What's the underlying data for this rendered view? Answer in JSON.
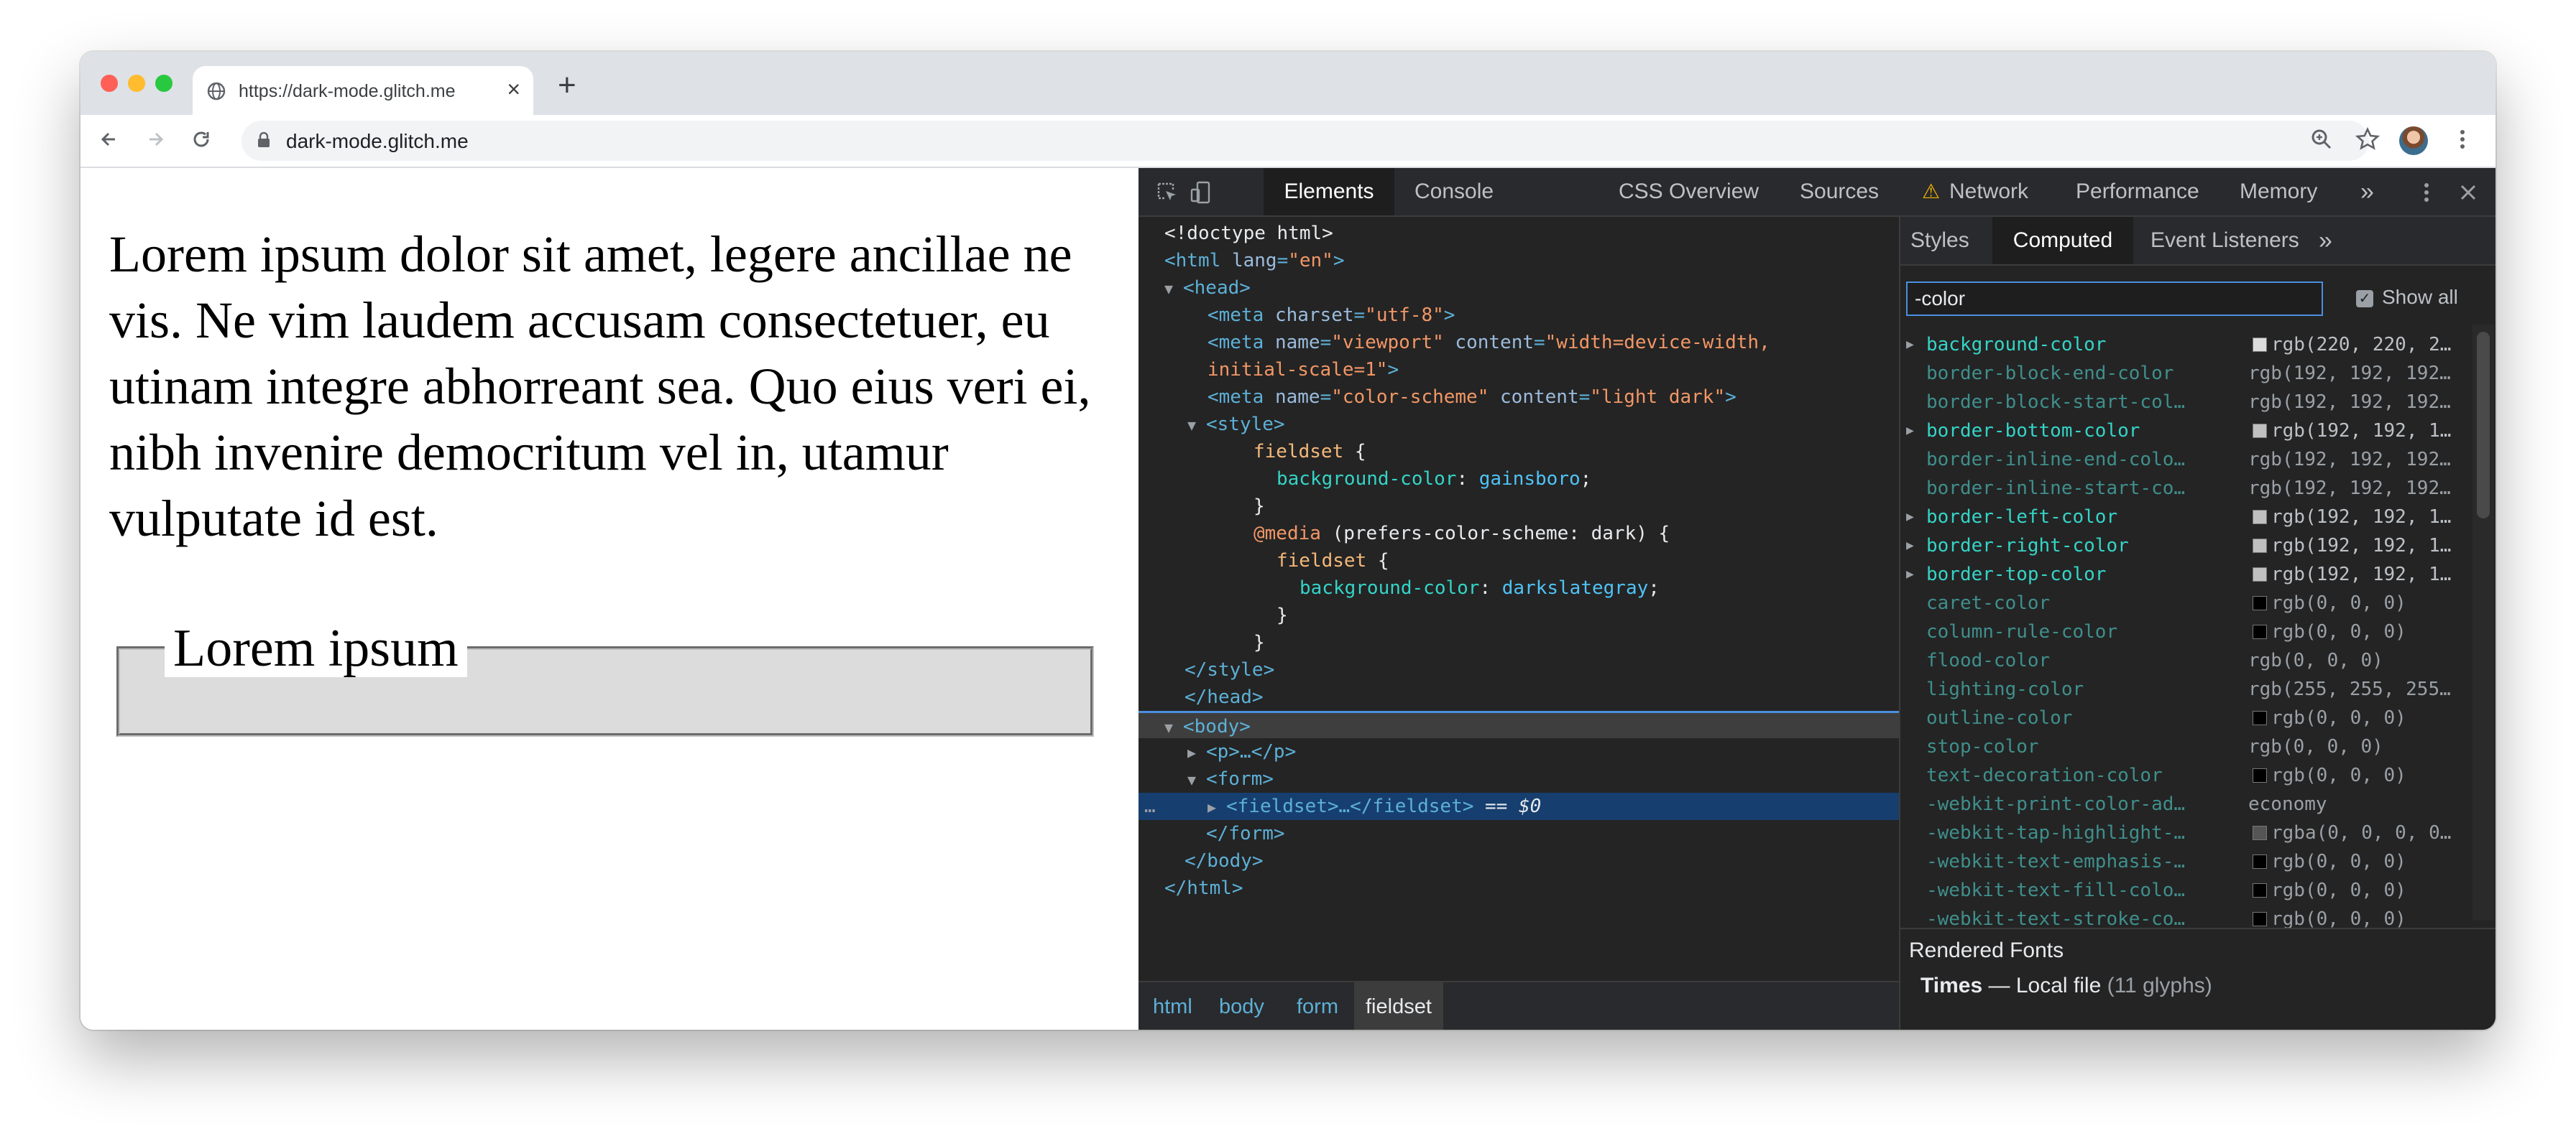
{
  "browser": {
    "tab_title": "https://dark-mode.glitch.me",
    "new_tab": "+",
    "address": "dark-mode.glitch.me"
  },
  "page": {
    "paragraph": "Lorem ipsum dolor sit amet, legere ancillae ne vis. Ne vim laudem accusam consectetuer, eu utinam integre abhorreant sea. Quo eius veri ei, nibh invenire democritum vel in, utamur vulputate id est.",
    "legend": "Lorem ipsum",
    "fieldset_bg": "#dcdcdc"
  },
  "devtools": {
    "tabs": [
      "Elements",
      "Console",
      "CSS Overview",
      "Sources",
      "Network",
      "Performance",
      "Memory"
    ],
    "more_tabs": "»",
    "network_warning": "⚠",
    "elements": {
      "doctype": "<!doctype html>",
      "html_open": "<html",
      "html_lang_attr": "lang",
      "html_lang_val": "\"en\"",
      "head_open": "<head>",
      "meta1_tag": "<meta",
      "meta1_attr": "charset",
      "meta1_val": "\"utf-8\"",
      "meta2_tag": "<meta",
      "meta2_name_attr": "name",
      "meta2_name_val": "\"viewport\"",
      "meta2_content_attr": "content",
      "meta2_content_val1": "\"width=device-width,",
      "meta2_content_val2": "initial-scale=1\"",
      "meta3_tag": "<meta",
      "meta3_name_attr": "name",
      "meta3_name_val": "\"color-scheme\"",
      "meta3_content_attr": "content",
      "meta3_content_val": "\"light dark\"",
      "style_open": "<style>",
      "css_sel1": "fieldset",
      "css_brace_open": "{",
      "css_prop1": "background-color",
      "css_val1": "gainsboro",
      "css_brace_close": "}",
      "css_at": "@media",
      "css_media_query": "(prefers-color-scheme: dark) {",
      "css_sel2": "fieldset",
      "css_prop2": "background-color",
      "css_val2": "darkslategray",
      "style_close": "</style>",
      "head_close": "</head>",
      "body_open": "<body>",
      "p_collapsed": "<p>…</p>",
      "form_open": "<form>",
      "fieldset_collapsed": "<fieldset>…</fieldset>",
      "dollar_zero": "== $0",
      "gutter_dots": "…",
      "form_close": "</form>",
      "body_close": "</body>",
      "html_close": "</html>"
    },
    "breadcrumbs": [
      "html",
      "body",
      "form",
      "fieldset"
    ],
    "side_tabs": [
      "Styles",
      "Computed",
      "Event Listeners"
    ],
    "side_more": "»",
    "filter_value": "-color",
    "show_all_label": "Show all",
    "show_all_checked": true,
    "computed": [
      {
        "name": "background-color",
        "value": "rgb(220, 220, 2…",
        "swatch": "#dcdcdc",
        "expandable": true,
        "inherited": true
      },
      {
        "name": "border-block-end-color",
        "value": "rgb(192, 192, 192…",
        "swatch": "",
        "expandable": false,
        "inherited": false
      },
      {
        "name": "border-block-start-col…",
        "value": "rgb(192, 192, 192…",
        "swatch": "",
        "expandable": false,
        "inherited": false
      },
      {
        "name": "border-bottom-color",
        "value": "rgb(192, 192, 1…",
        "swatch": "#c0c0c0",
        "expandable": true,
        "inherited": true
      },
      {
        "name": "border-inline-end-colo…",
        "value": "rgb(192, 192, 192…",
        "swatch": "",
        "expandable": false,
        "inherited": false
      },
      {
        "name": "border-inline-start-co…",
        "value": "rgb(192, 192, 192…",
        "swatch": "",
        "expandable": false,
        "inherited": false
      },
      {
        "name": "border-left-color",
        "value": "rgb(192, 192, 1…",
        "swatch": "#c0c0c0",
        "expandable": true,
        "inherited": true
      },
      {
        "name": "border-right-color",
        "value": "rgb(192, 192, 1…",
        "swatch": "#c0c0c0",
        "expandable": true,
        "inherited": true
      },
      {
        "name": "border-top-color",
        "value": "rgb(192, 192, 1…",
        "swatch": "#c0c0c0",
        "expandable": true,
        "inherited": true
      },
      {
        "name": "caret-color",
        "value": "rgb(0, 0, 0)",
        "swatch": "#000000",
        "expandable": false,
        "inherited": false
      },
      {
        "name": "column-rule-color",
        "value": "rgb(0, 0, 0)",
        "swatch": "#000000",
        "expandable": false,
        "inherited": false
      },
      {
        "name": "flood-color",
        "value": "rgb(0, 0, 0)",
        "swatch": "",
        "expandable": false,
        "inherited": false
      },
      {
        "name": "lighting-color",
        "value": "rgb(255, 255, 255…",
        "swatch": "",
        "expandable": false,
        "inherited": false
      },
      {
        "name": "outline-color",
        "value": "rgb(0, 0, 0)",
        "swatch": "#000000",
        "expandable": false,
        "inherited": false
      },
      {
        "name": "stop-color",
        "value": "rgb(0, 0, 0)",
        "swatch": "",
        "expandable": false,
        "inherited": false
      },
      {
        "name": "text-decoration-color",
        "value": "rgb(0, 0, 0)",
        "swatch": "#000000",
        "expandable": false,
        "inherited": false
      },
      {
        "name": "-webkit-print-color-ad…",
        "value": "economy",
        "swatch": "",
        "expandable": false,
        "inherited": false
      },
      {
        "name": "-webkit-tap-highlight-…",
        "value": "rgba(0, 0, 0, 0…",
        "swatch": "#555555",
        "expandable": false,
        "inherited": false
      },
      {
        "name": "-webkit-text-emphasis-…",
        "value": "rgb(0, 0, 0)",
        "swatch": "#000000",
        "expandable": false,
        "inherited": false
      },
      {
        "name": "-webkit-text-fill-colo…",
        "value": "rgb(0, 0, 0)",
        "swatch": "#000000",
        "expandable": false,
        "inherited": false
      },
      {
        "name": "-webkit-text-stroke-co…",
        "value": "rgb(0, 0, 0)",
        "swatch": "#000000",
        "expandable": false,
        "inherited": false
      }
    ],
    "rendered_fonts_label": "Rendered Fonts",
    "font_family": "Times",
    "font_dash": "—",
    "font_source": "Local file",
    "font_glyphs": "(11 glyphs)"
  }
}
